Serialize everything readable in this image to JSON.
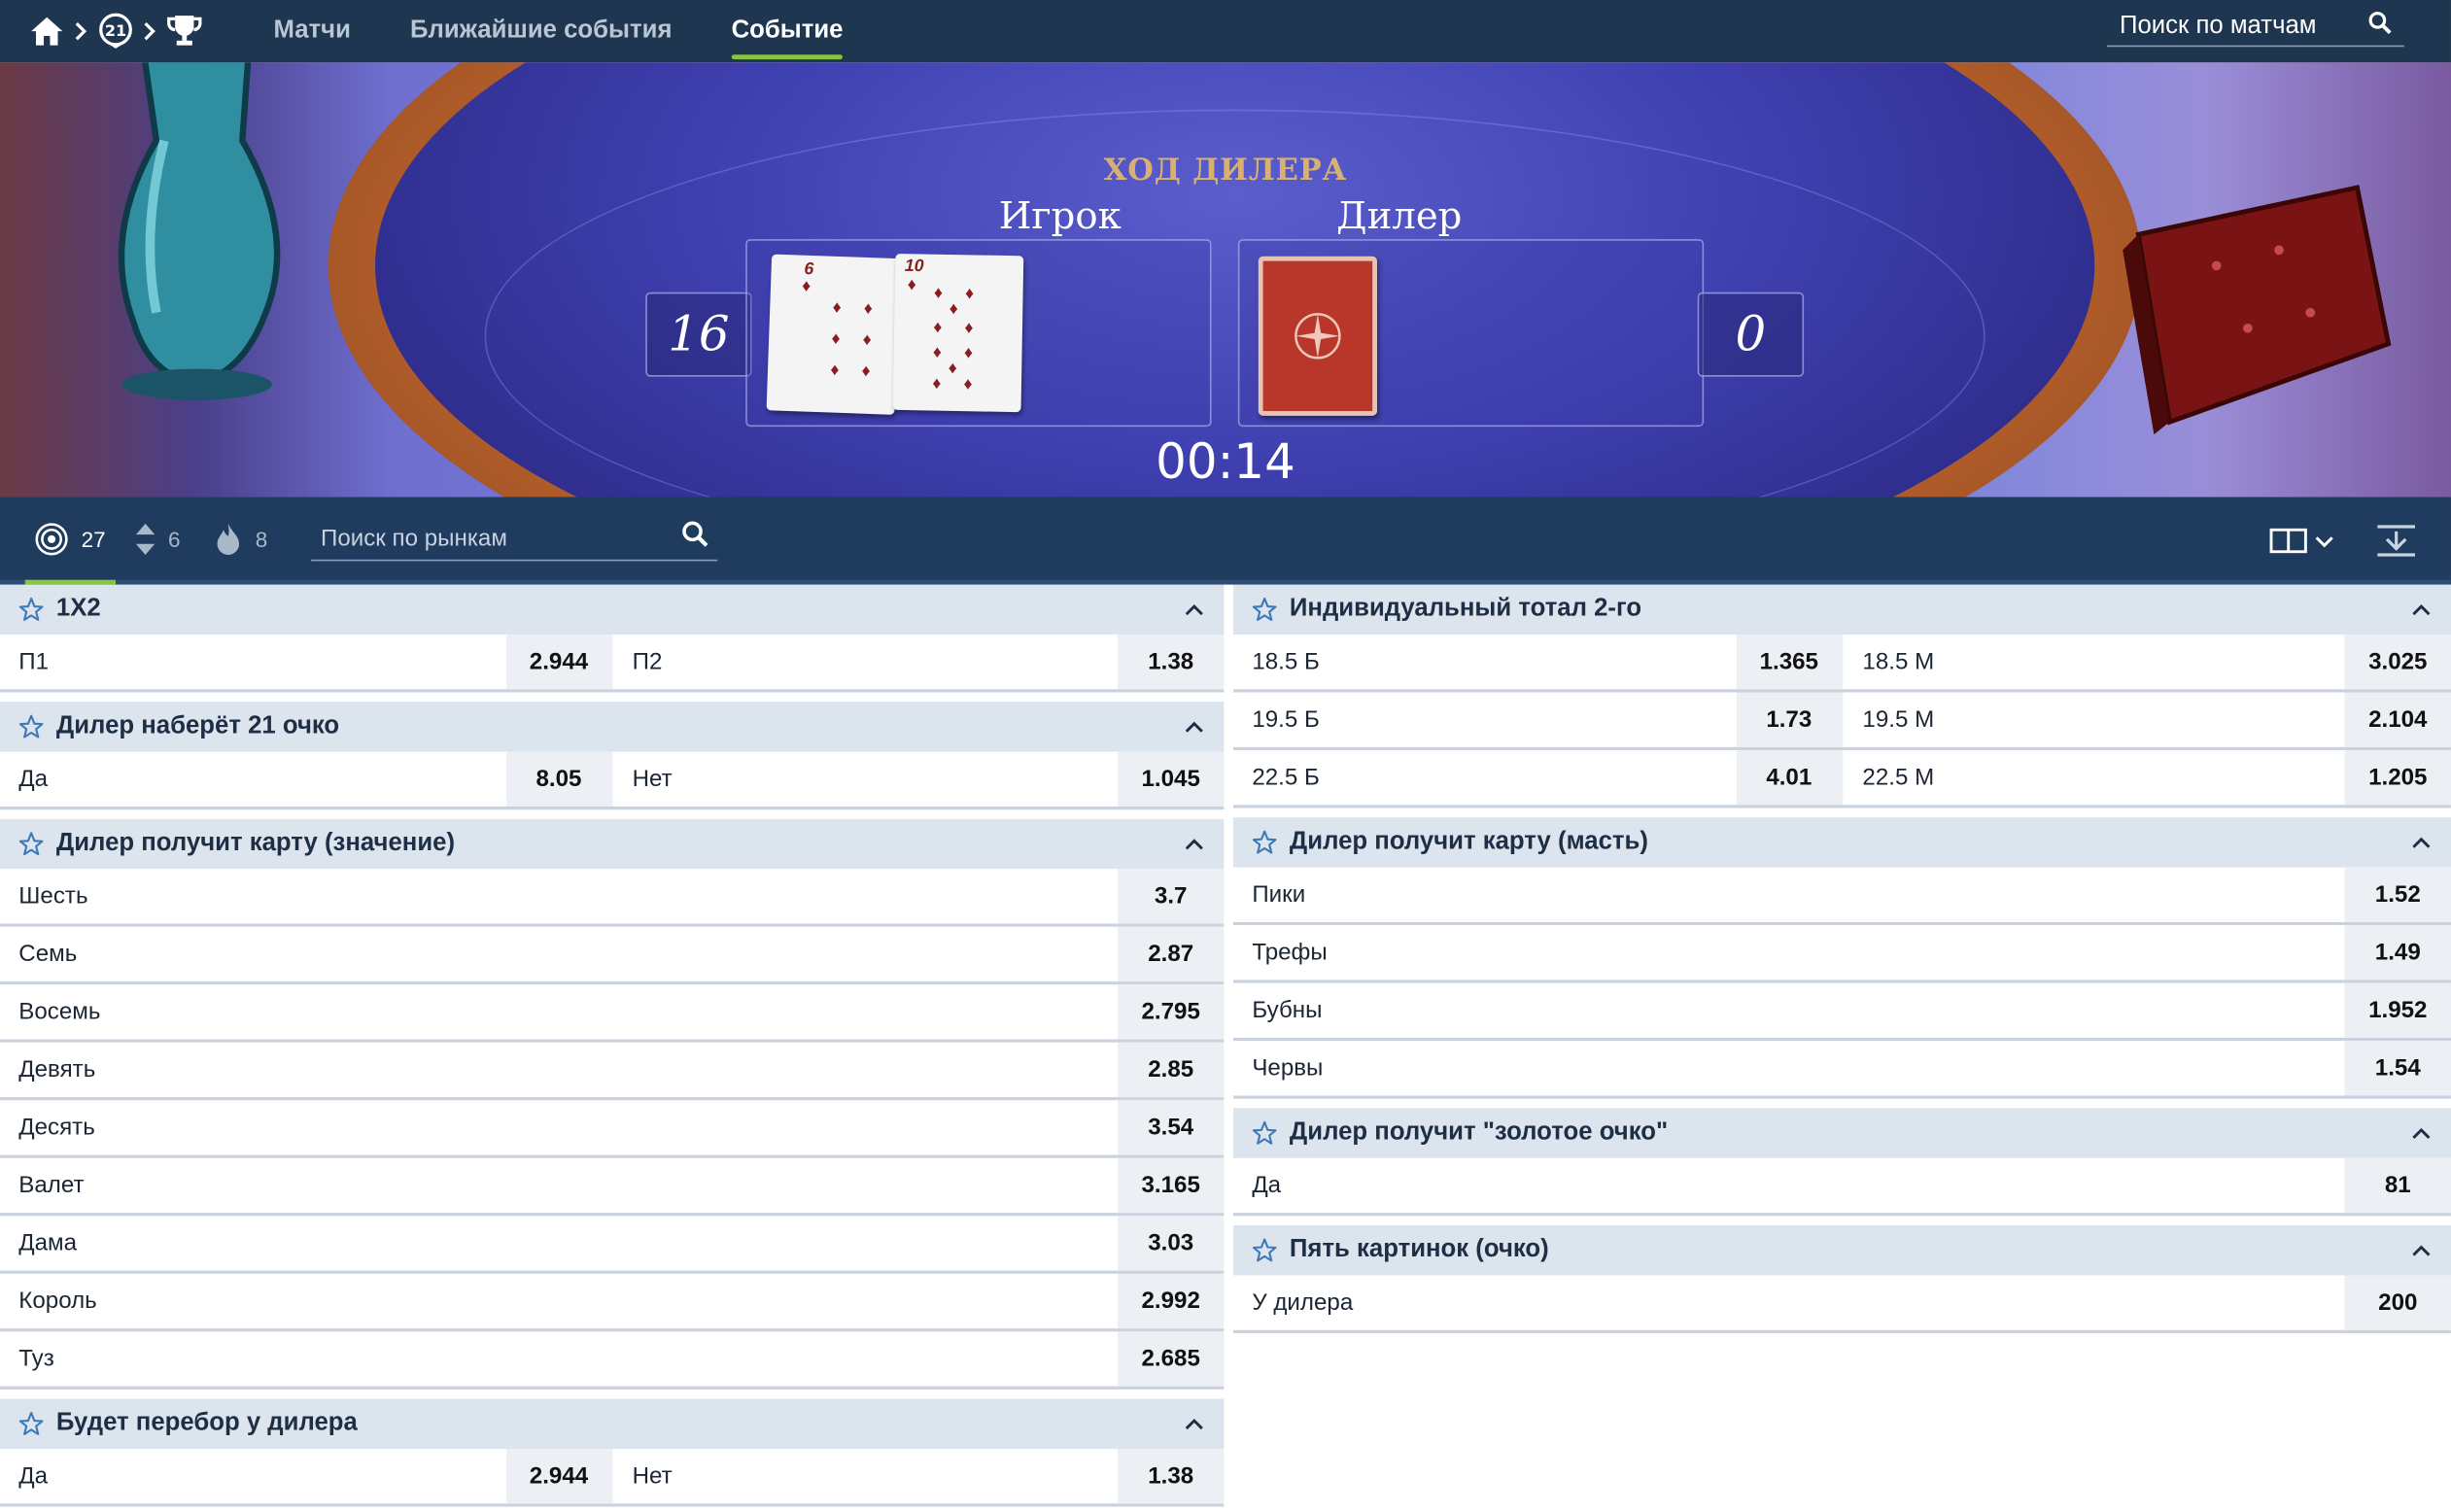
{
  "nav": {
    "tabs": [
      "Матчи",
      "Ближайшие события",
      "Событие"
    ],
    "active_tab": 2,
    "search_placeholder": "Поиск по матчам",
    "accent_color": "#8ac53f",
    "bg_color": "#1f3650",
    "icons": [
      "home-icon",
      "chevron-right-icon",
      "blackjack-21-icon",
      "chevron-right-icon",
      "trophy-icon",
      "search-icon"
    ]
  },
  "game": {
    "phase": "ХОД ДИЛЕРА",
    "player_label": "Игрок",
    "dealer_label": "Дилер",
    "player_score": "16",
    "dealer_score": "0",
    "timer": "00:14",
    "player_cards": [
      {
        "rank": "6",
        "suit": "diamonds"
      },
      {
        "rank": "10",
        "suit": "diamonds"
      }
    ],
    "dealer_cards": [
      {
        "face_down": true
      }
    ]
  },
  "markets_bar": {
    "all_count": "27",
    "sorted_count": "6",
    "hot_count": "8",
    "search_placeholder": "Поиск по рынкам",
    "icons": [
      "target-icon",
      "sort-arrows-icon",
      "flame-icon",
      "search-icon",
      "columns-layout-icon",
      "collapse-all-icon"
    ]
  },
  "markets": {
    "left": [
      {
        "title": "1X2",
        "rows": [
          [
            {
              "label": "П1",
              "odd": "2.944"
            },
            {
              "label": "П2",
              "odd": "1.38"
            }
          ]
        ]
      },
      {
        "title": "Дилер наберёт 21 очко",
        "rows": [
          [
            {
              "label": "Да",
              "odd": "8.05"
            },
            {
              "label": "Нет",
              "odd": "1.045"
            }
          ]
        ]
      },
      {
        "title": "Дилер получит карту (значение)",
        "rows": [
          [
            {
              "label": "Шесть",
              "odd": "3.7"
            }
          ],
          [
            {
              "label": "Семь",
              "odd": "2.87"
            }
          ],
          [
            {
              "label": "Восемь",
              "odd": "2.795"
            }
          ],
          [
            {
              "label": "Девять",
              "odd": "2.85"
            }
          ],
          [
            {
              "label": "Десять",
              "odd": "3.54"
            }
          ],
          [
            {
              "label": "Валет",
              "odd": "3.165"
            }
          ],
          [
            {
              "label": "Дама",
              "odd": "3.03"
            }
          ],
          [
            {
              "label": "Король",
              "odd": "2.992"
            }
          ],
          [
            {
              "label": "Туз",
              "odd": "2.685"
            }
          ]
        ]
      },
      {
        "title": "Будет перебор у дилера",
        "rows": [
          [
            {
              "label": "Да",
              "odd": "2.944"
            },
            {
              "label": "Нет",
              "odd": "1.38"
            }
          ]
        ]
      }
    ],
    "right": [
      {
        "title": "Индивидуальный тотал 2-го",
        "rows": [
          [
            {
              "label": "18.5 Б",
              "odd": "1.365"
            },
            {
              "label": "18.5 М",
              "odd": "3.025"
            }
          ],
          [
            {
              "label": "19.5 Б",
              "odd": "1.73"
            },
            {
              "label": "19.5 М",
              "odd": "2.104"
            }
          ],
          [
            {
              "label": "22.5 Б",
              "odd": "4.01"
            },
            {
              "label": "22.5 М",
              "odd": "1.205"
            }
          ]
        ]
      },
      {
        "title": "Дилер получит карту (масть)",
        "rows": [
          [
            {
              "label": "Пики",
              "odd": "1.52"
            }
          ],
          [
            {
              "label": "Трефы",
              "odd": "1.49"
            }
          ],
          [
            {
              "label": "Бубны",
              "odd": "1.952"
            }
          ],
          [
            {
              "label": "Червы",
              "odd": "1.54"
            }
          ]
        ]
      },
      {
        "title": "Дилер получит \"золотое очко\"",
        "rows": [
          [
            {
              "label": "Да",
              "odd": "81"
            }
          ]
        ]
      },
      {
        "title": "Пять картинок (очко)",
        "rows": [
          [
            {
              "label": "У дилера",
              "odd": "200"
            }
          ]
        ]
      }
    ]
  }
}
